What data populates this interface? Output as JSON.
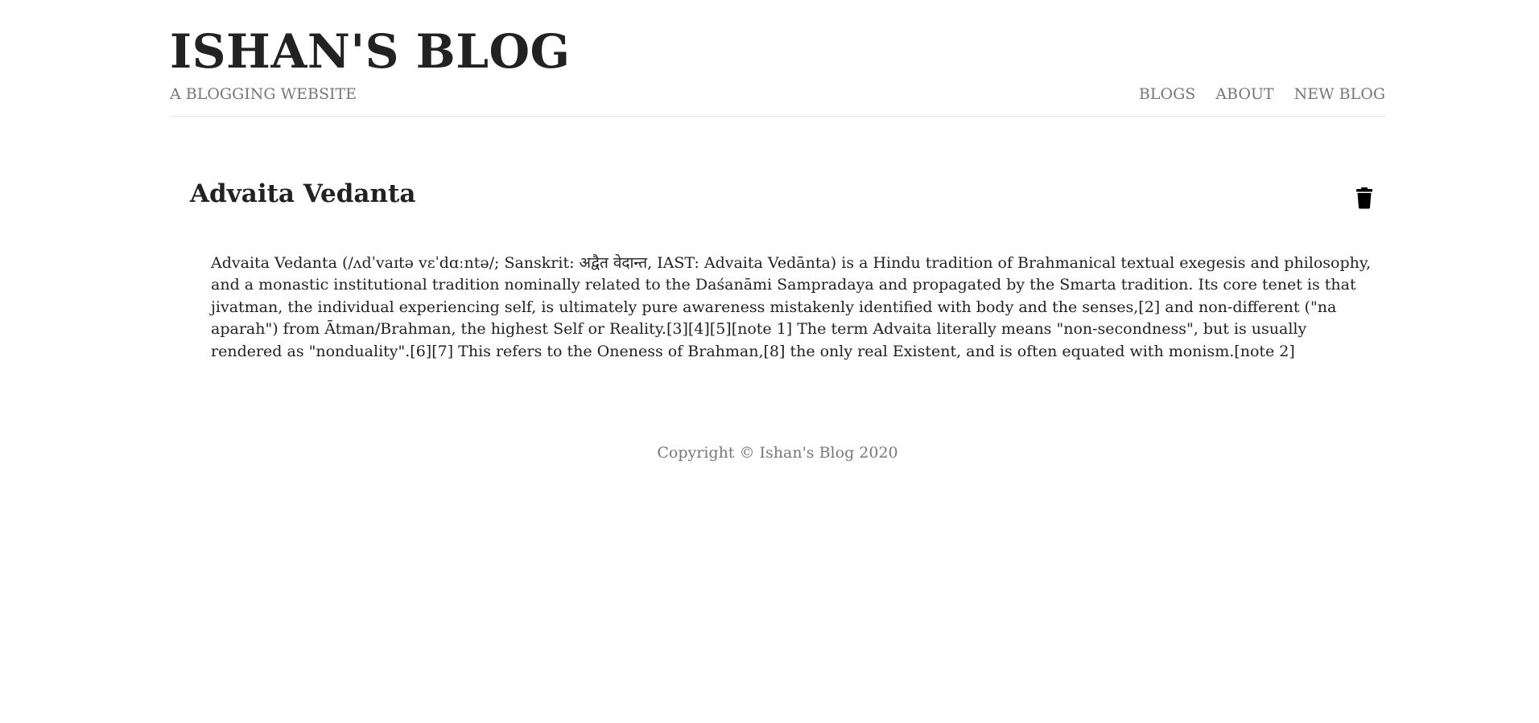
{
  "header": {
    "title": "ISHAN'S BLOG",
    "tagline": "A BLOGGING WEBSITE",
    "nav": [
      {
        "label": "BLOGS"
      },
      {
        "label": "ABOUT"
      },
      {
        "label": "NEW BLOG"
      }
    ]
  },
  "post": {
    "title": "Advaita Vedanta",
    "delete_icon": "trash-icon",
    "body": "Advaita Vedanta (/ʌdˈvaɪtə vɛˈdɑːntə/; Sanskrit: अद्वैत वेदान्त, IAST: Advaita Vedānta) is a Hindu tradition of Brahmanical textual exegesis and philosophy, and a monastic institutional tradition nominally related to the Daśanāmi Sampradaya and propagated by the Smarta tradition. Its core tenet is that jivatman, the individual experiencing self, is ultimately pure awareness mistakenly identified with body and the senses,[2] and non-different (\"na aparah\") from Ātman/Brahman, the highest Self or Reality.[3][4][5][note 1] The term Advaita literally means \"non-secondness\", but is usually rendered as \"nonduality\".[6][7] This refers to the Oneness of Brahman,[8] the only real Existent, and is often equated with monism.[note 2]"
  },
  "footer": {
    "copyright": "Copyright © Ishan's Blog 2020"
  }
}
